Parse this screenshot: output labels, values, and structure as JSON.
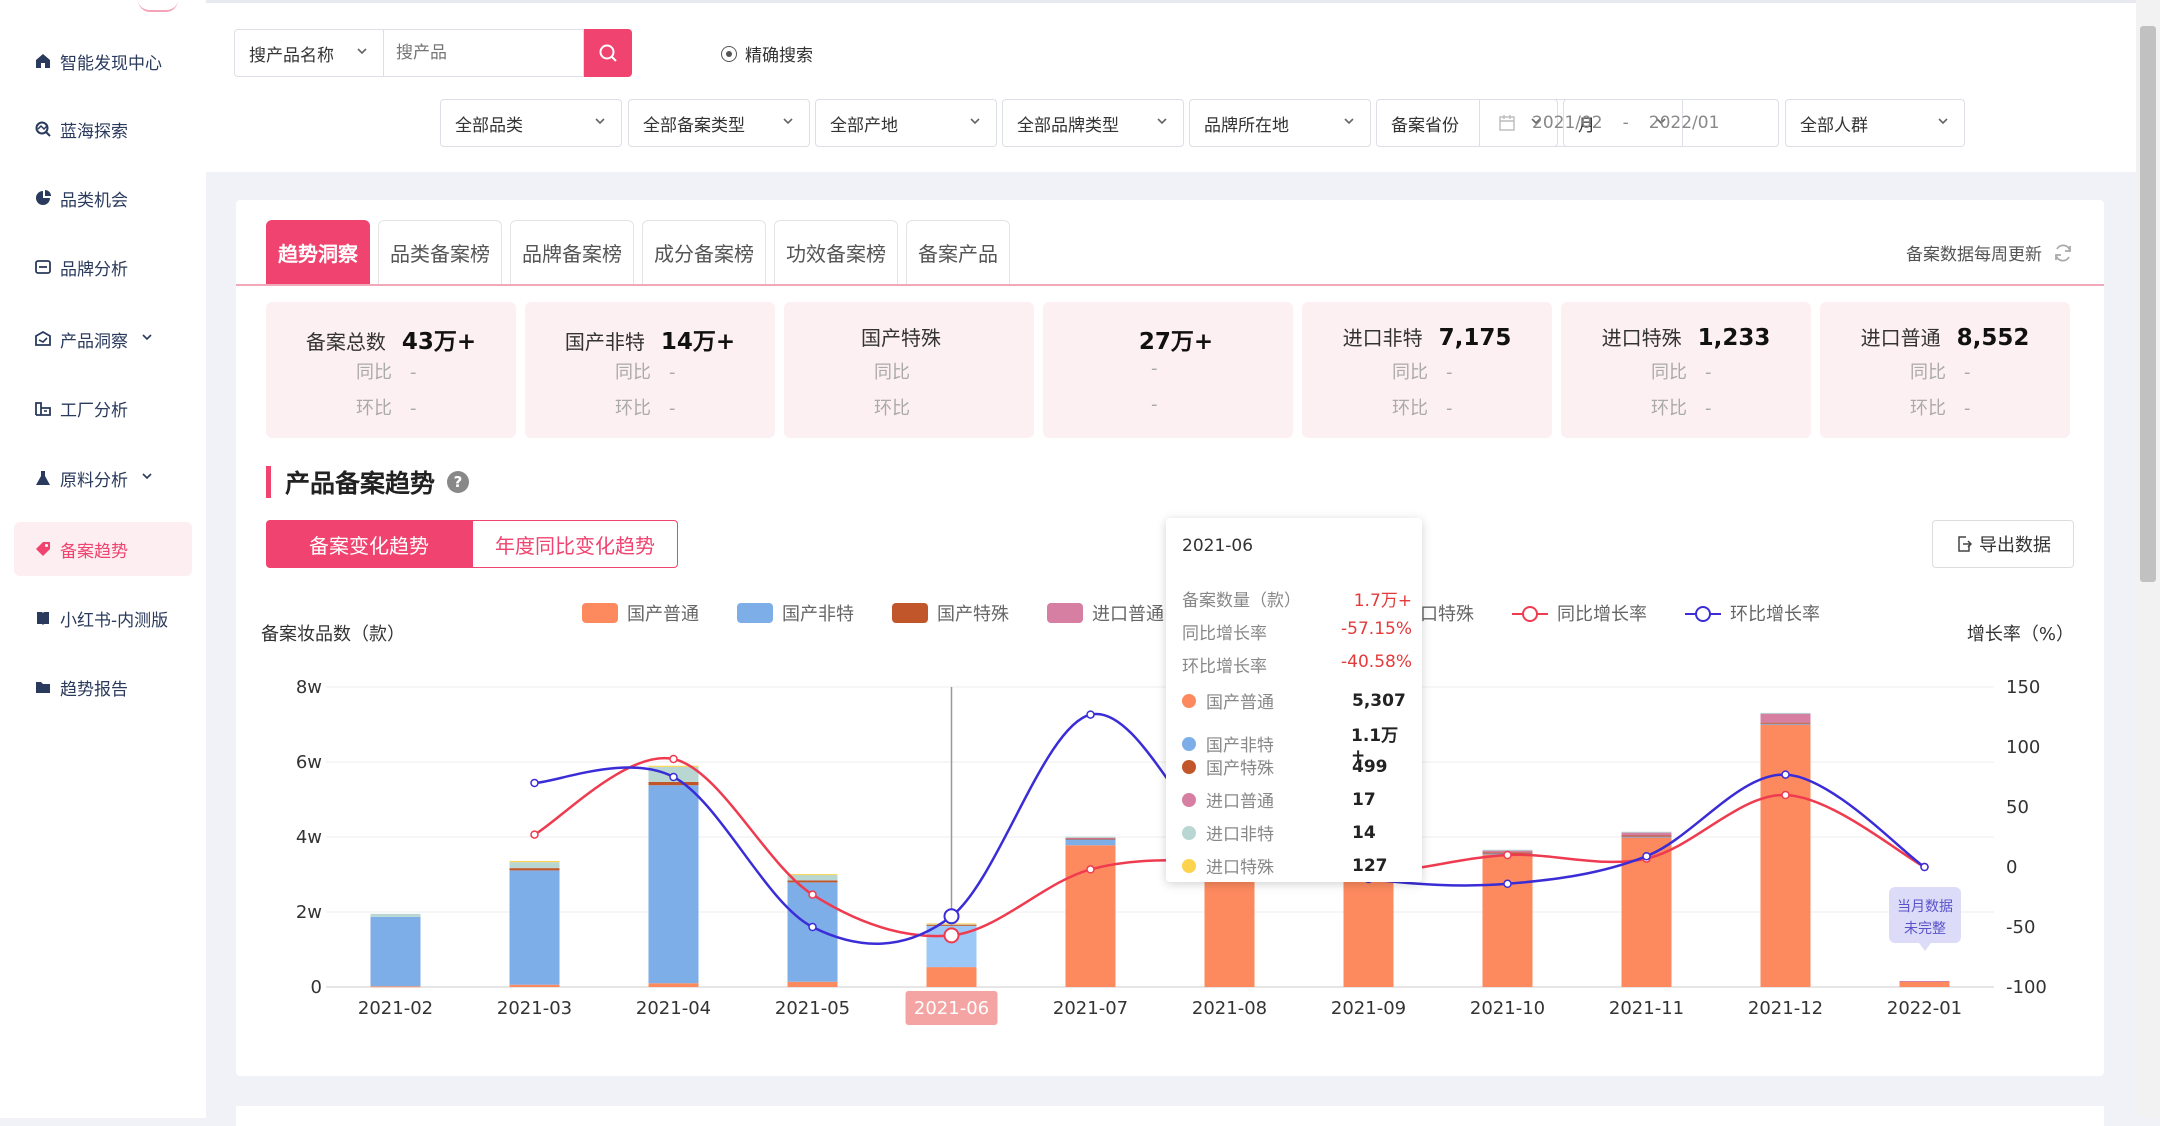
{
  "sidebar": {
    "items": [
      {
        "label": "智能发现中心",
        "icon": "home-icon"
      },
      {
        "label": "蓝海探索",
        "icon": "explore-icon"
      },
      {
        "label": "品类机会",
        "icon": "pie-icon"
      },
      {
        "label": "品牌分析",
        "icon": "brand-icon"
      },
      {
        "label": "产品洞察",
        "icon": "product-icon",
        "expandable": true
      },
      {
        "label": "工厂分析",
        "icon": "factory-icon"
      },
      {
        "label": "原料分析",
        "icon": "flask-icon",
        "expandable": true
      },
      {
        "label": "备案趋势",
        "icon": "tag-icon",
        "active": true
      },
      {
        "label": "小红书-内测版",
        "icon": "book-icon"
      },
      {
        "label": "趋势报告",
        "icon": "folder-icon"
      }
    ]
  },
  "search": {
    "type_label": "搜产品名称",
    "placeholder": "搜产品",
    "exact_label": "精确搜索"
  },
  "filters": [
    "全部品类",
    "全部备案类型",
    "全部产地",
    "全部品牌类型",
    "品牌所在地",
    "备案省份",
    "月"
  ],
  "date_range": {
    "start": "2021/02",
    "sep": "-",
    "end": "2022/01"
  },
  "crowd_filter": "全部人群",
  "tabs": [
    "趋势洞察",
    "品类备案榜",
    "品牌备案榜",
    "成分备案榜",
    "功效备案榜",
    "备案产品"
  ],
  "update_note": "备案数据每周更新",
  "stats": [
    {
      "title": "备案总数",
      "value": "43万+",
      "yoy_label": "同比",
      "yoy": "-",
      "mom_label": "环比",
      "mom": "-"
    },
    {
      "title": "国产非特",
      "value": "14万+",
      "yoy_label": "同比",
      "yoy": "-",
      "mom_label": "环比",
      "mom": "-"
    },
    {
      "title": "国产特殊",
      "value": "",
      "yoy_label": "同比",
      "yoy": "",
      "mom_label": "环比",
      "mom": ""
    },
    {
      "title": "",
      "value": "27万+",
      "yoy_label": "",
      "yoy": "-",
      "mom_label": "",
      "mom": "-"
    },
    {
      "title": "进口非特",
      "value": "7,175",
      "yoy_label": "同比",
      "yoy": "-",
      "mom_label": "环比",
      "mom": "-"
    },
    {
      "title": "进口特殊",
      "value": "1,233",
      "yoy_label": "同比",
      "yoy": "-",
      "mom_label": "环比",
      "mom": "-"
    },
    {
      "title": "进口普通",
      "value": "8,552",
      "yoy_label": "同比",
      "yoy": "-",
      "mom_label": "环比",
      "mom": "-"
    }
  ],
  "section_title": "产品备案趋势",
  "help": "?",
  "subtabs": [
    "备案变化趋势",
    "年度同比变化趋势"
  ],
  "export_label": "导出数据",
  "tooltip": {
    "date": "2021-06",
    "rows": [
      {
        "label": "备案数量（款）",
        "value": "1.7万+"
      },
      {
        "label": "同比增长率",
        "value": "-57.15%"
      },
      {
        "label": "环比增长率",
        "value": "-40.58%"
      }
    ],
    "series": [
      {
        "label": "国产普通",
        "value": "5,307",
        "color": "#fd8a5e"
      },
      {
        "label": "国产非特",
        "value": "1.1万+",
        "color": "#7eaee8"
      },
      {
        "label": "国产特殊",
        "value": "499",
        "color": "#c0562a"
      },
      {
        "label": "进口普通",
        "value": "17",
        "color": "#d67fa2"
      },
      {
        "label": "进口非特",
        "value": "14",
        "color": "#b8d7d2"
      },
      {
        "label": "进口特殊",
        "value": "127",
        "color": "#fdd34d"
      }
    ]
  },
  "incomplete_note": [
    "当月数据",
    "未完整"
  ],
  "chart_data": {
    "type": "bar",
    "ylabel": "备案妆品数（款）",
    "y2label": "增长率（%）",
    "categories": [
      "2021-02",
      "2021-03",
      "2021-04",
      "2021-05",
      "2021-06",
      "2021-07",
      "2021-08",
      "2021-09",
      "2021-10",
      "2021-11",
      "2021-12",
      "2022-01"
    ],
    "highlight": "2021-06",
    "ylim": [
      0,
      80000
    ],
    "yticks": [
      "0",
      "2w",
      "4w",
      "6w",
      "8w"
    ],
    "y2lim": [
      -100,
      150
    ],
    "y2ticks": [
      "-100",
      "-50",
      "0",
      "50",
      "100",
      "150"
    ],
    "stack_series": [
      {
        "name": "国产普通",
        "color": "#fd8a5e",
        "values": [
          200,
          600,
          1000,
          1400,
          5307,
          37800,
          45000,
          40500,
          35500,
          40000,
          70000,
          1500
        ]
      },
      {
        "name": "国产非特",
        "color": "#7eaee8",
        "values": [
          18500,
          30500,
          52800,
          26500,
          11000,
          1600,
          300,
          200,
          100,
          100,
          200,
          0
        ]
      },
      {
        "name": "国产特殊",
        "color": "#c0562a",
        "values": [
          0,
          600,
          900,
          500,
          499,
          200,
          300,
          300,
          300,
          300,
          300,
          0
        ]
      },
      {
        "name": "进口普通",
        "color": "#d67fa2",
        "values": [
          0,
          0,
          0,
          0,
          17,
          200,
          500,
          700,
          600,
          900,
          2500,
          100
        ]
      },
      {
        "name": "进口非特",
        "color": "#b8d7d2",
        "values": [
          800,
          1600,
          4000,
          1500,
          14,
          300,
          200,
          100,
          100,
          100,
          100,
          0
        ]
      },
      {
        "name": "进口特殊",
        "color": "#fdd34d",
        "values": [
          0,
          300,
          300,
          200,
          127,
          0,
          0,
          0,
          0,
          0,
          0,
          0
        ]
      }
    ],
    "line_series": [
      {
        "name": "同比增长率",
        "color": "#ef3b4f",
        "values": [
          null,
          27,
          90,
          -23,
          -57,
          -2,
          5,
          -5,
          10,
          7,
          60,
          0
        ]
      },
      {
        "name": "环比增长率",
        "color": "#3a2cd6",
        "values": [
          null,
          70,
          75,
          -50,
          -41,
          127,
          13,
          -10,
          -14,
          9,
          77,
          0
        ]
      }
    ],
    "legend": [
      "国产普通",
      "国产非特",
      "国产特殊",
      "进口普通",
      "进口非特",
      "进口特殊",
      "同比增长率",
      "环比增长率"
    ],
    "legend_placement": "top",
    "grid": true
  }
}
